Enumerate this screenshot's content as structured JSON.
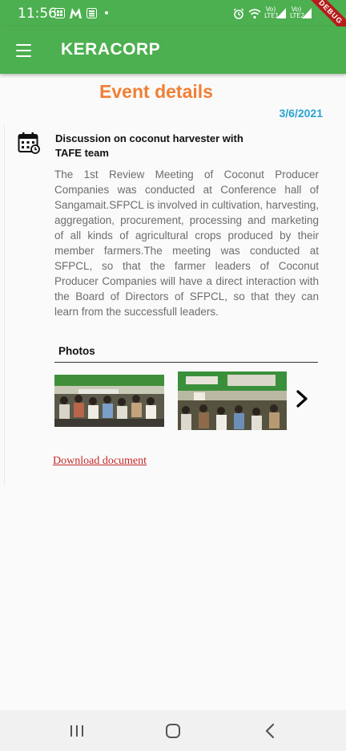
{
  "status_bar": {
    "time": "11:56",
    "signal1_label": "Vo) LTE1",
    "signal2_label": "Vo) LTE2"
  },
  "app_bar": {
    "title": "KERACORP",
    "debug_banner": "DEBUG"
  },
  "event": {
    "heading": "Event details",
    "date": "3/6/2021",
    "title": "Discussion on coconut harvester with TAFE team",
    "description": "The 1st Review Meeting of Coconut Producer Companies was conducted  at Conference  hall of Sangamait.SFPCL  is  involved  in cultivation, harvesting,  aggregation, procurement,  processing and marketing of  all kinds of agricultural crops produced by their member farmers.The  meeting was  conducted  at  SFPCL,  so  that  the  farmer leaders  of  Coconut  Producer  Companies  will have  a direct interaction with the Board of Directors of SFPCL, so that they can learn from the successfull leaders.",
    "photos_label": "Photos",
    "download_label": "Download document"
  },
  "colors": {
    "appbar": "#4caf50",
    "heading": "#f07f35",
    "date": "#29a3d0",
    "link": "#c62828"
  },
  "icons": {
    "menu": "hamburger-menu-icon",
    "calendar": "calendar-icon",
    "next": "chevron-right-icon",
    "nav_recents": "recents-icon",
    "nav_home": "home-icon",
    "nav_back": "back-icon"
  }
}
